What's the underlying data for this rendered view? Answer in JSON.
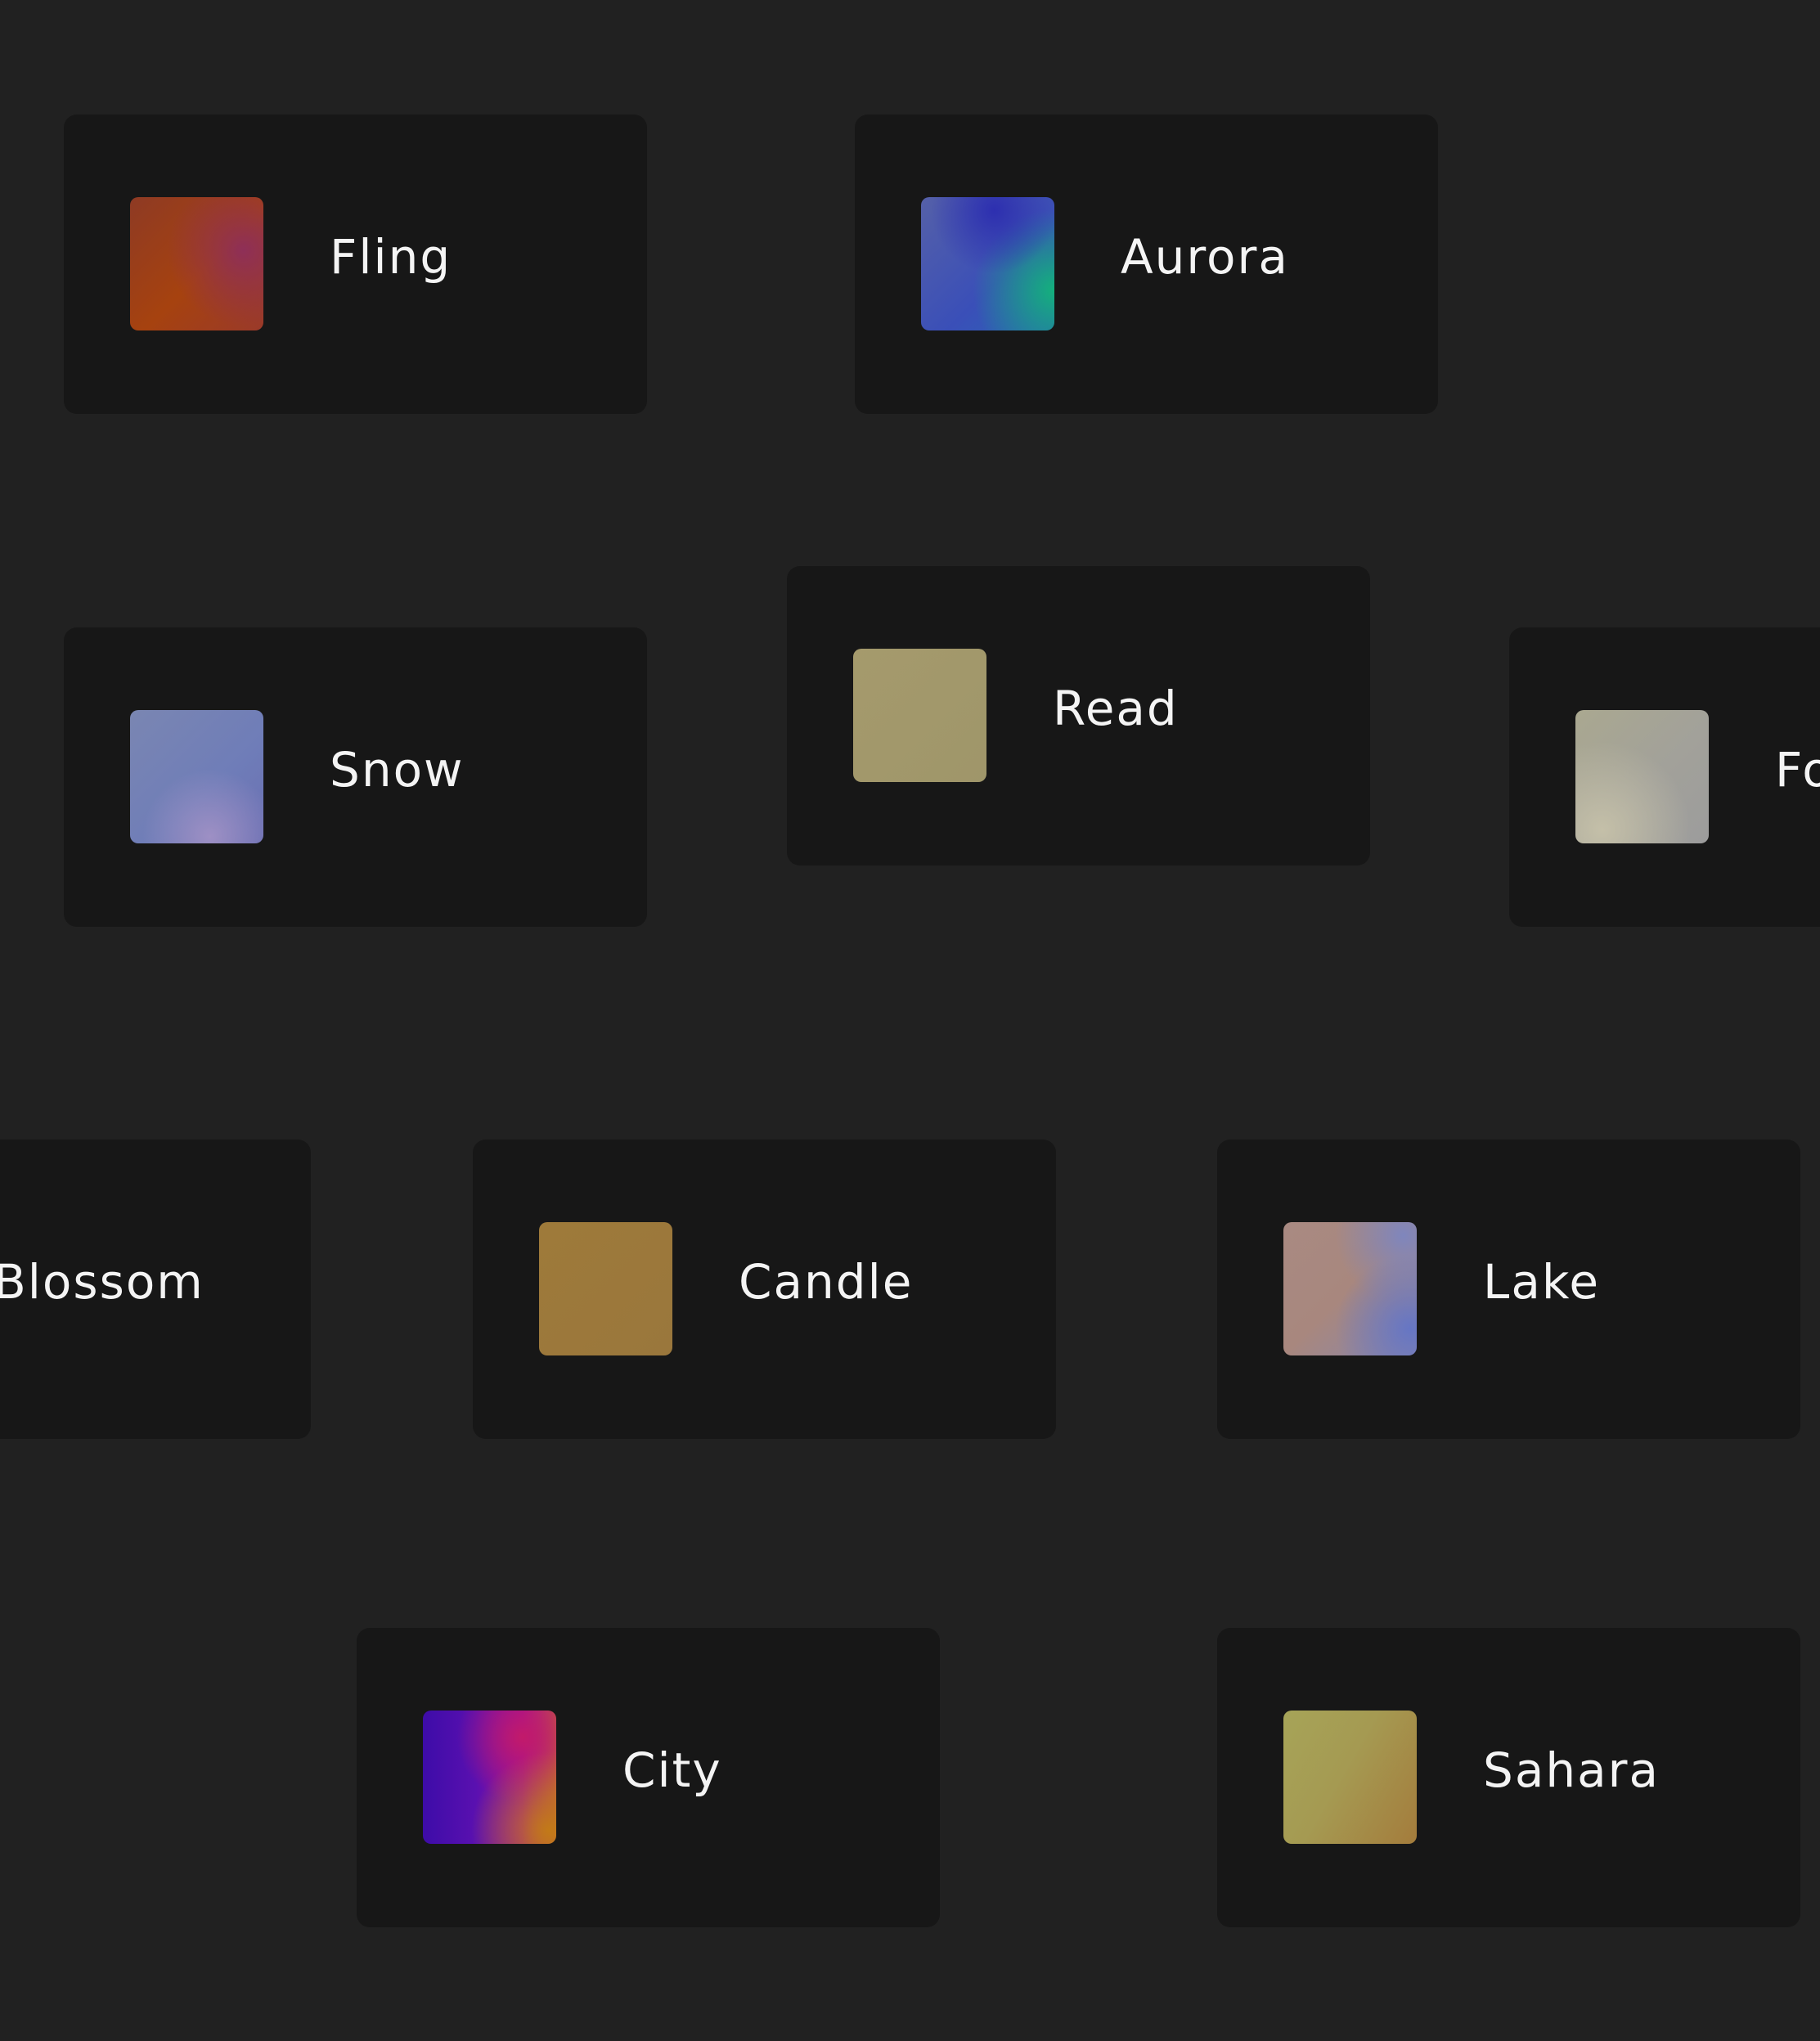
{
  "colors": {
    "background": "#212121",
    "card": "#171717",
    "text": "#f4f4f4"
  },
  "cards": [
    {
      "id": "fling",
      "label": "Fling"
    },
    {
      "id": "aurora",
      "label": "Aurora"
    },
    {
      "id": "snow",
      "label": "Snow"
    },
    {
      "id": "read",
      "label": "Read"
    },
    {
      "id": "fog",
      "label": "Fo"
    },
    {
      "id": "blossom",
      "label": "Blossom"
    },
    {
      "id": "candle",
      "label": "Candle"
    },
    {
      "id": "lake",
      "label": "Lake"
    },
    {
      "id": "city",
      "label": "City"
    },
    {
      "id": "sahara",
      "label": "Sahara"
    }
  ]
}
